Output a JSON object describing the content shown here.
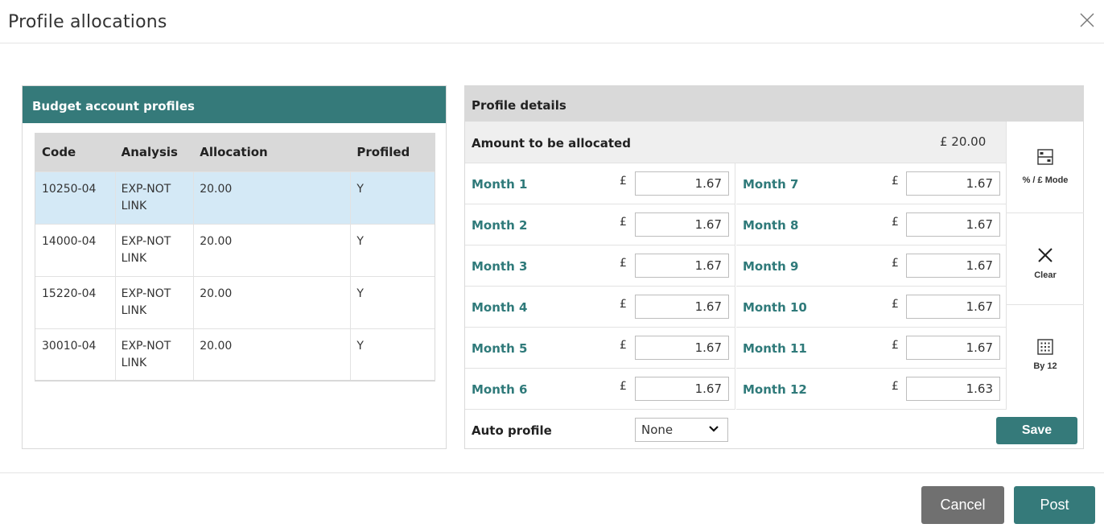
{
  "dialog": {
    "title": "Profile allocations"
  },
  "left": {
    "header": "Budget account profiles",
    "columns": [
      "Code",
      "Analysis",
      "Allocation",
      "Profiled"
    ],
    "rows": [
      {
        "code": "10250-04",
        "analysis": "EXP-NOT LINK",
        "allocation": "20.00",
        "profiled": "Y",
        "selected": true
      },
      {
        "code": "14000-04",
        "analysis": "EXP-NOT LINK",
        "allocation": "20.00",
        "profiled": "Y",
        "selected": false
      },
      {
        "code": "15220-04",
        "analysis": "EXP-NOT LINK",
        "allocation": "20.00",
        "profiled": "Y",
        "selected": false
      },
      {
        "code": "30010-04",
        "analysis": "EXP-NOT LINK",
        "allocation": "20.00",
        "profiled": "Y",
        "selected": false
      }
    ]
  },
  "right": {
    "header": "Profile details",
    "amount_label": "Amount to be allocated",
    "amount_value": "£ 20.00",
    "currency_symbol": "£",
    "months_left": [
      {
        "label": "Month 1",
        "value": "1.67"
      },
      {
        "label": "Month 2",
        "value": "1.67"
      },
      {
        "label": "Month 3",
        "value": "1.67"
      },
      {
        "label": "Month 4",
        "value": "1.67"
      },
      {
        "label": "Month 5",
        "value": "1.67"
      },
      {
        "label": "Month 6",
        "value": "1.67"
      }
    ],
    "months_right": [
      {
        "label": "Month 7",
        "value": "1.67"
      },
      {
        "label": "Month 8",
        "value": "1.67"
      },
      {
        "label": "Month 9",
        "value": "1.67"
      },
      {
        "label": "Month 10",
        "value": "1.67"
      },
      {
        "label": "Month 11",
        "value": "1.67"
      },
      {
        "label": "Month 12",
        "value": "1.63"
      }
    ],
    "auto_profile_label": "Auto profile",
    "auto_profile_value": "None",
    "save_label": "Save",
    "tools": [
      {
        "label": "% / £ Mode",
        "icon": "mode-toggle-icon"
      },
      {
        "label": "Clear",
        "icon": "close-icon"
      },
      {
        "label": "By 12",
        "icon": "grid-icon"
      }
    ]
  },
  "footer": {
    "cancel_label": "Cancel",
    "post_label": "Post"
  },
  "colors": {
    "accent": "#357a7a",
    "selected_row": "#d4e9f6",
    "header_gray": "#d9d9d9",
    "cancel_gray": "#707070"
  }
}
